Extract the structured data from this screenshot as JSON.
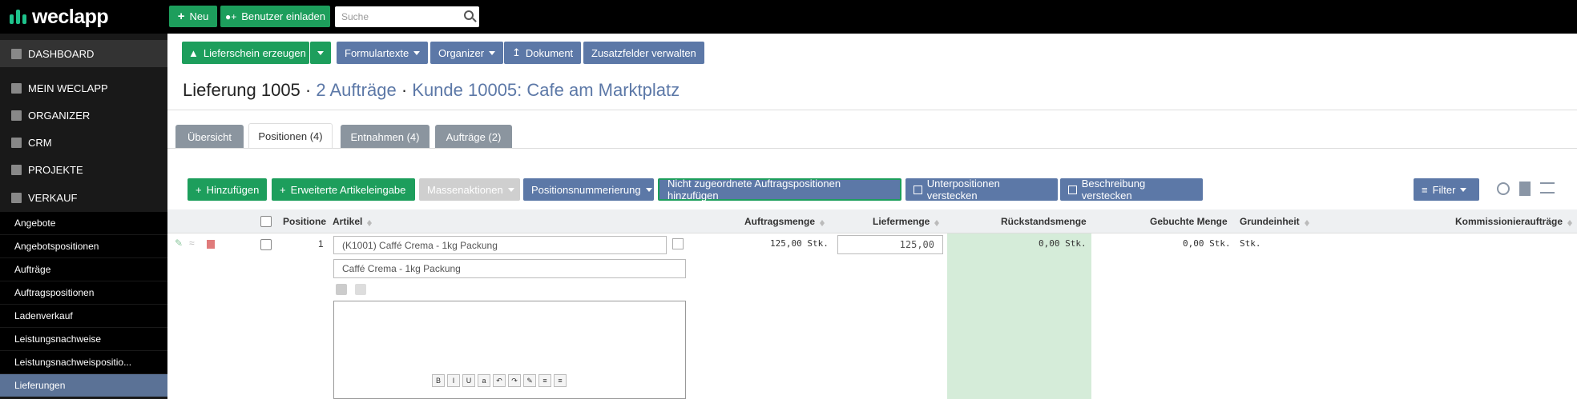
{
  "app": {
    "logo": "weclapp"
  },
  "topbar": {
    "new_label": "Neu",
    "invite_label": "Benutzer einladen",
    "search_placeholder": "Suche"
  },
  "sidebar": {
    "main": [
      {
        "label": "DASHBOARD",
        "icon": "grid-icon"
      },
      {
        "label": "MEIN WECLAPP",
        "icon": "home-icon"
      },
      {
        "label": "ORGANIZER",
        "icon": "envelope-icon"
      },
      {
        "label": "CRM",
        "icon": "users-icon"
      },
      {
        "label": "PROJEKTE",
        "icon": "briefcase-icon"
      },
      {
        "label": "VERKAUF",
        "icon": "tag-icon"
      }
    ],
    "sub": [
      "Angebote",
      "Angebotspositionen",
      "Aufträge",
      "Auftragspositionen",
      "Ladenverkauf",
      "Leistungsnachweise",
      "Leistungsnachweispositio...",
      "Lieferungen"
    ]
  },
  "toolbar": {
    "create_delivery": "Lieferschein erzeugen",
    "form_texts": "Formulartexte",
    "organizer": "Organizer",
    "document": "Dokument",
    "extra_fields": "Zusatzfelder verwalten"
  },
  "header": {
    "title": "Lieferung 1005",
    "orders_link": "2 Aufträge",
    "customer_link": "Kunde 10005: Cafe am Marktplatz",
    "sep": "·"
  },
  "tabs": [
    "Übersicht",
    "Positionen (4)",
    "Entnahmen (4)",
    "Aufträge (2)"
  ],
  "actions": {
    "add": "Hinzufügen",
    "extended_entry": "Erweiterte Artikeleingabe",
    "mass_actions": "Massenaktionen",
    "numbering": "Positionsnummerierung",
    "add_unassigned": "Nicht zugeordnete Auftragspositionen hinzufügen",
    "hide_subpositions": "Unterpositionen verstecken",
    "hide_description": "Beschreibung verstecken",
    "filter": "Filter"
  },
  "table": {
    "headers": [
      "Positione",
      "Artikel",
      "Auftragsmenge",
      "Liefermenge",
      "Rückstandsmenge",
      "Gebuchte Menge",
      "Grundeinheit",
      "Kommissionieraufträge"
    ],
    "rows": [
      {
        "position": "1",
        "article": "(K1001) Caffé Crema - 1kg Packung",
        "article_name": "Caffé Crema - 1kg Packung",
        "order_qty": "125,00 Stk.",
        "delivery_qty": "125,00",
        "backorder_qty": "0,00 Stk.",
        "booked_qty": "0,00 Stk.",
        "base_unit": "Stk."
      }
    ]
  },
  "colors": {
    "green": "#1d9e5c",
    "blue": "#5c78a7",
    "sidebar": "#191919",
    "backorder_bg": "#d5ecd9"
  }
}
